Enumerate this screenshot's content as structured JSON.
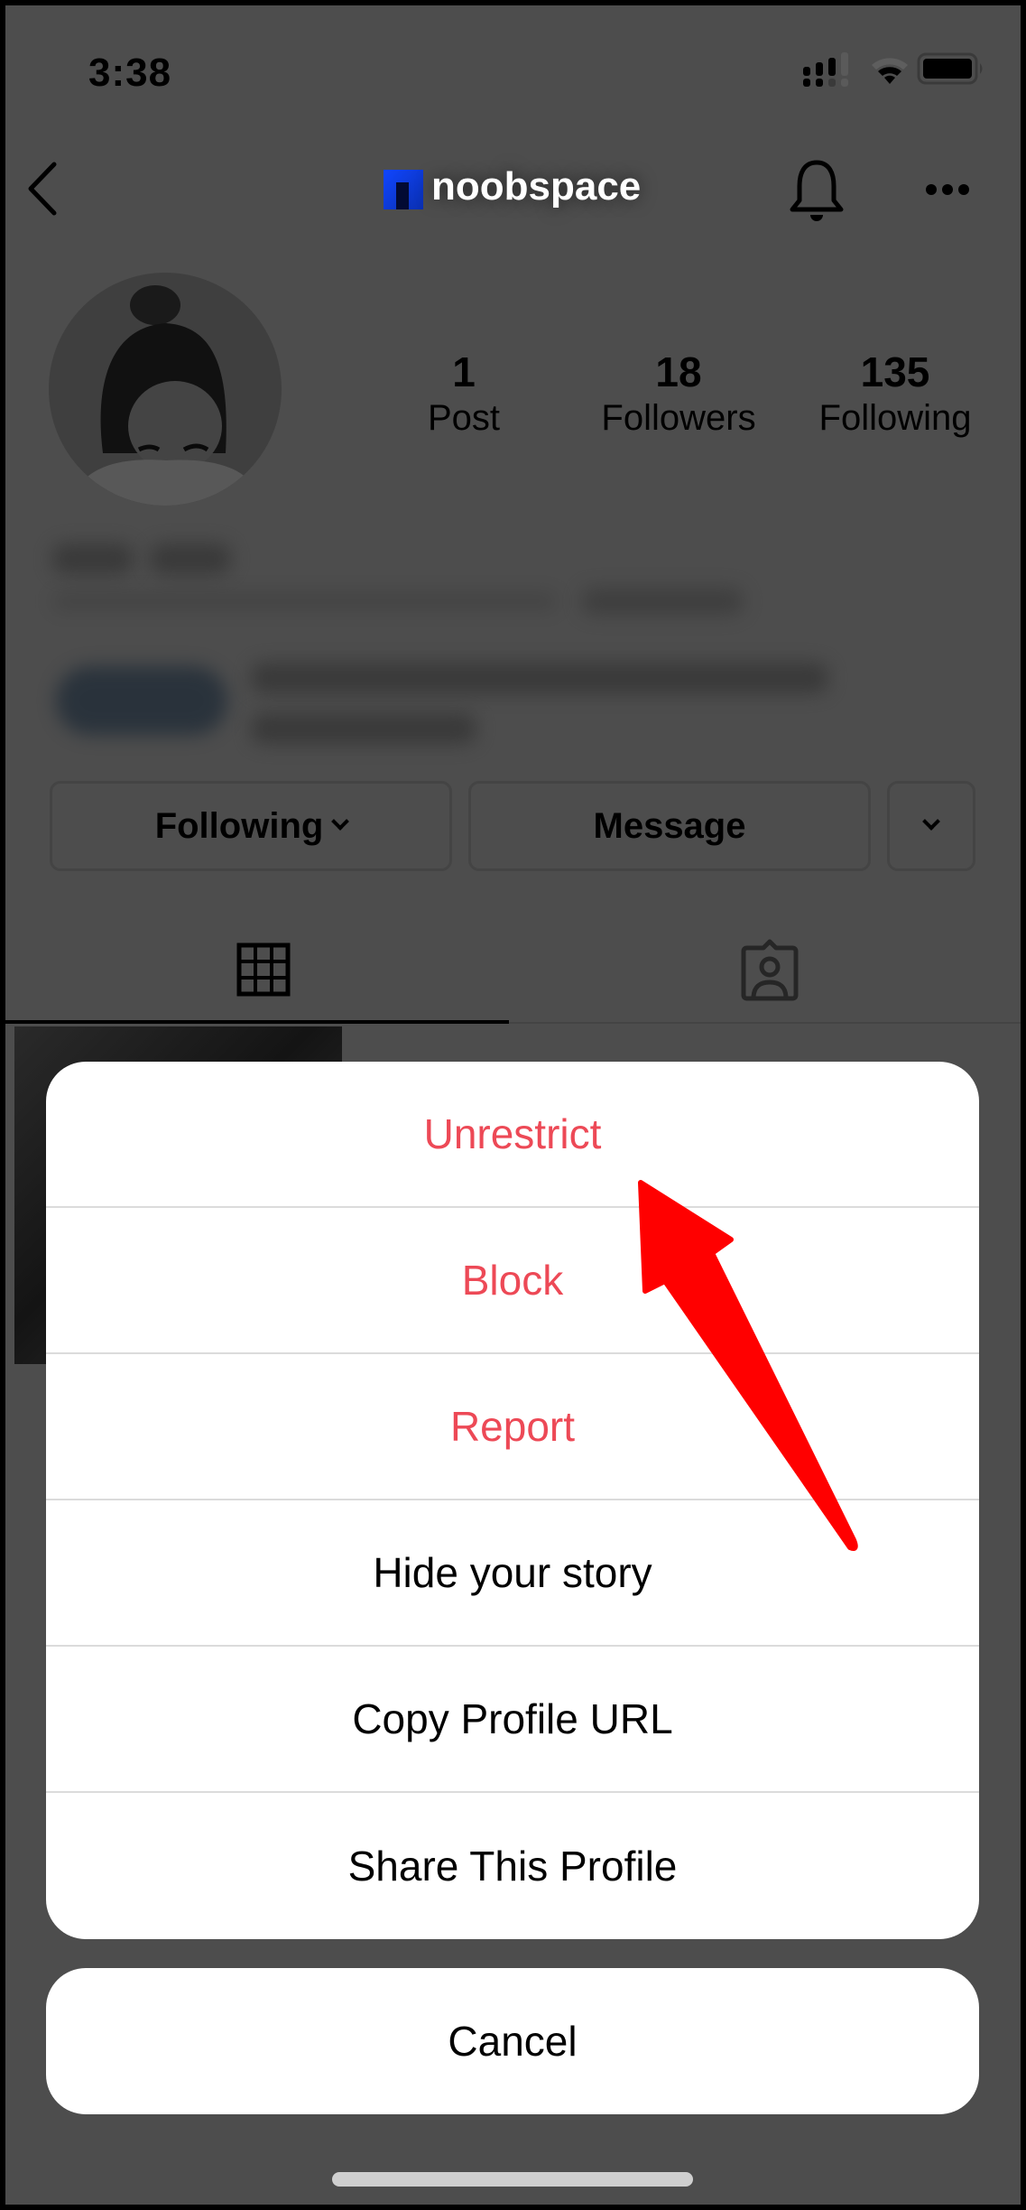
{
  "status_bar": {
    "time": "3:38",
    "icons": [
      "cellular-signal-icon",
      "wifi-icon",
      "battery-icon"
    ]
  },
  "nav": {
    "back_icon": "chevron-left-icon",
    "brand": "noobspace",
    "bell_icon": "bell-icon",
    "more_icon": "more-horizontal-icon"
  },
  "profile": {
    "stats": [
      {
        "value": "1",
        "label": "Post"
      },
      {
        "value": "18",
        "label": "Followers"
      },
      {
        "value": "135",
        "label": "Following"
      }
    ],
    "buttons": {
      "following": "Following",
      "message": "Message"
    },
    "tabs": [
      "grid-icon",
      "tagged-icon"
    ]
  },
  "action_sheet": {
    "items": [
      {
        "label": "Unrestrict",
        "style": "destructive"
      },
      {
        "label": "Block",
        "style": "destructive"
      },
      {
        "label": "Report",
        "style": "destructive"
      },
      {
        "label": "Hide your story",
        "style": "default"
      },
      {
        "label": "Copy Profile URL",
        "style": "default"
      },
      {
        "label": "Share This Profile",
        "style": "default"
      }
    ],
    "cancel": "Cancel"
  },
  "colors": {
    "destructive": "#ed4956",
    "annotation_arrow": "#ff0000",
    "overlay": "#4d4d4d"
  }
}
